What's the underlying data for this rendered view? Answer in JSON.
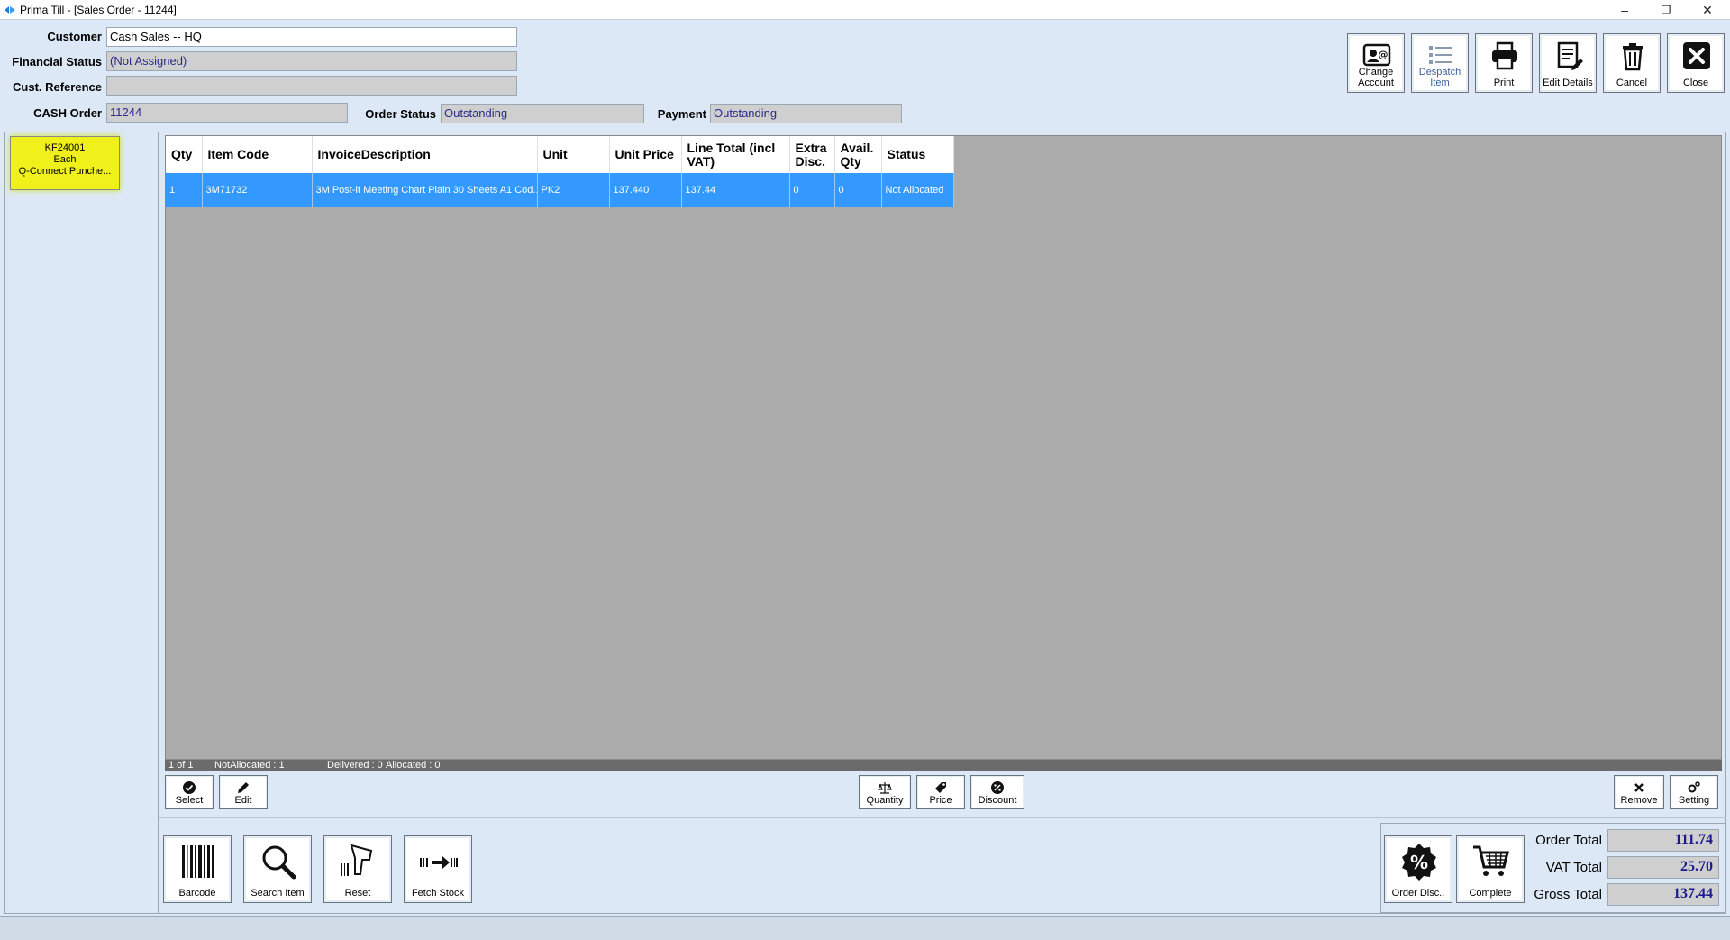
{
  "window": {
    "title": "Prima Till - [Sales Order - 11244]",
    "minimize": "–",
    "restore": "❐",
    "close": "✕"
  },
  "header": {
    "customer_label": "Customer",
    "customer_value": "Cash Sales -- HQ",
    "financial_status_label": "Financial Status",
    "financial_status_value": "(Not Assigned)",
    "cust_reference_label": "Cust. Reference",
    "cust_reference_value": "",
    "cash_order_label": "CASH Order",
    "cash_order_value": "11244",
    "order_status_label": "Order Status",
    "order_status_value": "Outstanding",
    "payment_label": "Payment",
    "payment_value": "Outstanding"
  },
  "toolbar": {
    "change_account": "Change Account",
    "despatch_item": "Despatch Item",
    "print": "Print",
    "edit_details": "Edit Details",
    "cancel": "Cancel",
    "close": "Close"
  },
  "left_panel": {
    "tile_code": "KF24001",
    "tile_unit": "Each",
    "tile_desc": "Q-Connect Punche..."
  },
  "grid": {
    "columns": {
      "qty": "Qty",
      "item_code": "Item Code",
      "description": "InvoiceDescription",
      "unit": "Unit",
      "unit_price": "Unit Price",
      "line_total": "Line Total (incl VAT)",
      "extra_disc": "Extra Disc.",
      "avail_qty": "Avail. Qty",
      "status": "Status"
    },
    "rows": [
      {
        "qty": "1",
        "item_code": "3M71732",
        "description": "3M Post-it Meeting Chart Plain 30 Sheets A1 Cod...",
        "unit": "PK2",
        "unit_price": "137.440",
        "line_total": "137.44",
        "extra_disc": "0",
        "avail_qty": "0",
        "status": "Not Allocated"
      }
    ]
  },
  "statusbar": {
    "position": "1 of 1",
    "not_allocated": "NotAllocated : 1",
    "delivered": "Delivered : 0",
    "allocated": "Allocated : 0"
  },
  "actions": {
    "select": "Select",
    "edit": "Edit",
    "quantity": "Quantity",
    "price": "Price",
    "discount": "Discount",
    "remove": "Remove",
    "setting": "Setting"
  },
  "bottom": {
    "barcode": "Barcode",
    "search_item": "Search Item",
    "reset": "Reset",
    "fetch_stock": "Fetch Stock",
    "order_disc": "Order Disc..",
    "complete": "Complete"
  },
  "totals": {
    "order_total_label": "Order Total",
    "order_total_value": "111.74",
    "vat_total_label": "VAT Total",
    "vat_total_value": "25.70",
    "gross_total_label": "Gross Total",
    "gross_total_value": "137.44"
  }
}
